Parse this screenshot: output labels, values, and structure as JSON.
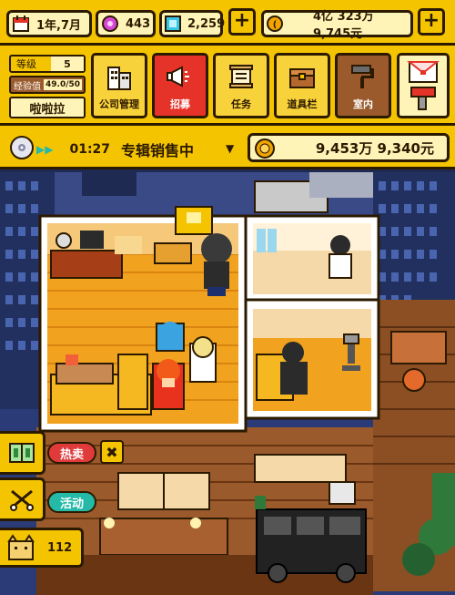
{
  "topbar": {
    "date": "1年,7月",
    "gems": "443",
    "diamonds": "2,259",
    "fans": "4亿 323万 9,745元"
  },
  "profile": {
    "level_label": "等级",
    "level_value": "5",
    "exp_label": "经验值",
    "exp_value": "49.0/50",
    "exp_progress": 0.98,
    "name": "啦啦拉"
  },
  "menu": {
    "company": "公司管理",
    "recruit": "招募",
    "task": "任务",
    "items": "道具栏",
    "room": "室内"
  },
  "status": {
    "timer": "01:27",
    "activity": "专辑销售中",
    "money": "9,453万 9,340元"
  },
  "side": {
    "hot_sale": "热卖",
    "event": "活动",
    "count": "112"
  },
  "colors": {
    "accent": "#f5c400",
    "outline": "#2b1a00",
    "recruit": "#e5332a",
    "tag": "#e03a3a",
    "tag_green": "#25b9a8"
  }
}
